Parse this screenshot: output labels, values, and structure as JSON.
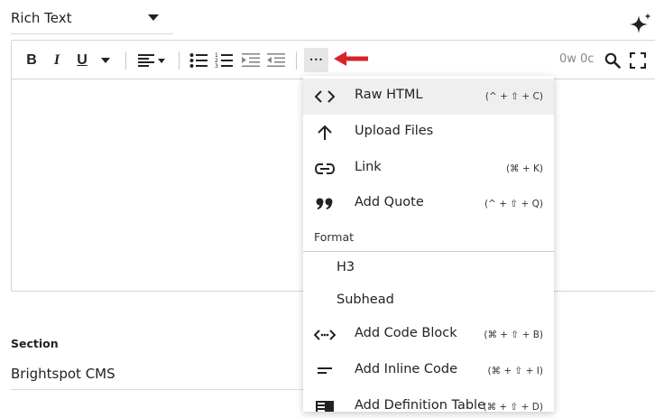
{
  "mode_select": {
    "value": "Rich Text"
  },
  "editor": {
    "word_count": "0w 0c",
    "toolbar": {
      "bold": "B",
      "italic": "I",
      "underline": "U",
      "more": "•••"
    }
  },
  "menu": {
    "items": [
      {
        "label": "Raw HTML",
        "shortcut": "(^ + ⇧ + C)",
        "icon": "code-icon",
        "highlighted": true
      },
      {
        "label": "Upload Files",
        "shortcut": "",
        "icon": "arrow-up-icon"
      },
      {
        "label": "Link",
        "shortcut": "(⌘ + K)",
        "icon": "link-icon"
      },
      {
        "label": "Add Quote",
        "shortcut": "(^ + ⇧ + Q)",
        "icon": "quote-icon"
      }
    ],
    "format_heading": "Format",
    "format_items": [
      {
        "label": "H3"
      },
      {
        "label": "Subhead"
      },
      {
        "label": "Add Code Block",
        "shortcut": "(⌘ + ⇧ + B)",
        "icon": "code-block-icon"
      },
      {
        "label": "Add Inline Code",
        "shortcut": "(⌘ + ⇧ + I)",
        "icon": "inline-code-icon"
      },
      {
        "label": "Add Definition Table",
        "shortcut": "(⌘ + ⇧ + D)",
        "icon": "table-icon"
      }
    ]
  },
  "section": {
    "label": "Section",
    "value": "Brightspot CMS"
  },
  "colors": {
    "arrow": "#d9222a",
    "highlight": "#efefef",
    "text": "#222222"
  }
}
